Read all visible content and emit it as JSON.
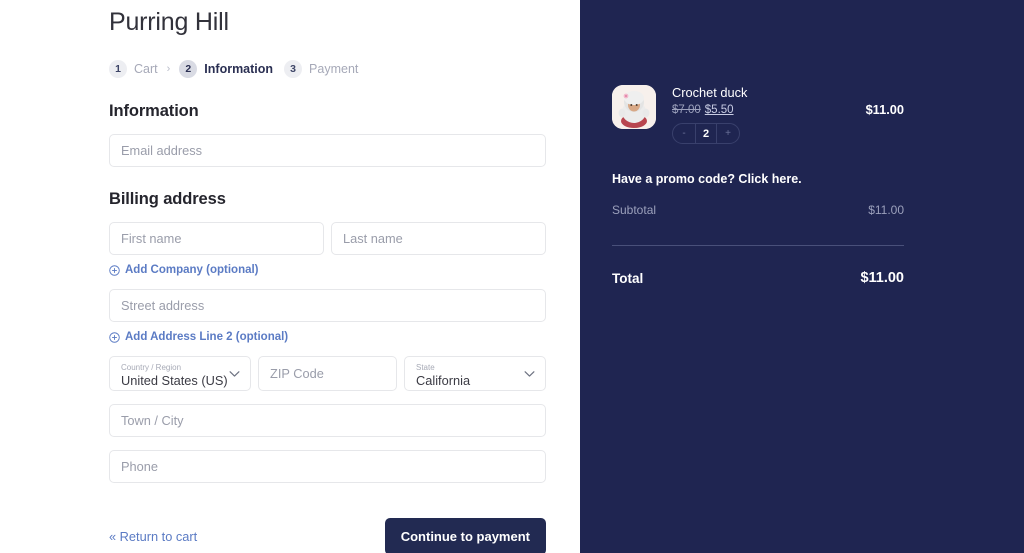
{
  "shop": {
    "title": "Purring Hill"
  },
  "steps": [
    {
      "num": "1",
      "label": "Cart",
      "sep": "›"
    },
    {
      "num": "2",
      "label": "Information",
      "sep": ""
    },
    {
      "num": "3",
      "label": "Payment",
      "sep": ""
    }
  ],
  "information": {
    "heading": "Information",
    "email_placeholder": "Email address"
  },
  "billing": {
    "heading": "Billing address",
    "first_name_placeholder": "First name",
    "last_name_placeholder": "Last name",
    "add_company_label": "Add Company (optional)",
    "street_placeholder": "Street address",
    "add_address2_label": "Add Address Line 2 (optional)",
    "country_label": "Country / Region",
    "country_value": "United States (US)",
    "zip_placeholder": "ZIP Code",
    "state_label": "State",
    "state_value": "California",
    "city_placeholder": "Town / City",
    "phone_placeholder": "Phone"
  },
  "actions": {
    "return_to_cart": "« Return to cart",
    "continue_to_payment": "Continue to payment"
  },
  "summary": {
    "item": {
      "name": "Crochet duck",
      "price_old": "$7.00",
      "price_new": "$5.50",
      "quantity": "2",
      "decrement": "-",
      "increment": "+",
      "line_total": "$11.00"
    },
    "promo_text": "Have a promo code? Click here.",
    "subtotal_label": "Subtotal",
    "subtotal_value": "$11.00",
    "total_label": "Total",
    "total_value": "$11.00"
  },
  "colors": {
    "sidebar_bg": "#1f2551",
    "primary_button": "#222a52",
    "link_blue": "#5b7bc4",
    "muted_text": "#9a9daa"
  }
}
